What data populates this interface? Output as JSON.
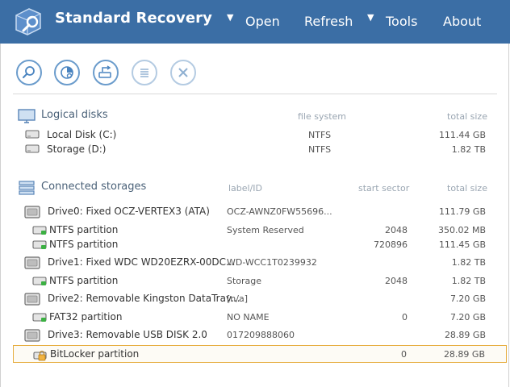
{
  "app": {
    "title": "Standard Recovery"
  },
  "menu": {
    "open": "Open",
    "refresh": "Refresh",
    "tools": "Tools",
    "about": "About",
    "arrow": "▼"
  },
  "toolbar": [
    {
      "name": "search-icon",
      "enabled": true
    },
    {
      "name": "scan-icon",
      "enabled": true
    },
    {
      "name": "image-disk-icon",
      "enabled": true
    },
    {
      "name": "list-icon",
      "enabled": false
    },
    {
      "name": "close-icon",
      "enabled": false
    }
  ],
  "logical": {
    "title": "Logical disks",
    "col_fs": "file system",
    "col_size": "total size",
    "rows": [
      {
        "name": "Local Disk (C:)",
        "fs": "NTFS",
        "size": "111.44 GB"
      },
      {
        "name": "Storage (D:)",
        "fs": "NTFS",
        "size": "1.82 TB"
      }
    ]
  },
  "storages": {
    "title": "Connected storages",
    "col_label": "label/ID",
    "col_sector": "start sector",
    "col_size": "total size",
    "rows": [
      {
        "kind": "drive",
        "name": "Drive0: Fixed OCZ-VERTEX3 (ATA)",
        "label": "OCZ-AWNZ0FW55696...",
        "sector": "",
        "size": "111.79 GB"
      },
      {
        "kind": "partition",
        "name": "NTFS partition",
        "label": "System Reserved",
        "sector": "2048",
        "size": "350.02 MB"
      },
      {
        "kind": "partition",
        "name": "NTFS partition",
        "label": "",
        "sector": "720896",
        "size": "111.45 GB"
      },
      {
        "kind": "drive",
        "name": "Drive1: Fixed WDC WD20EZRX-00DC...",
        "label": "WD-WCC1T0239932",
        "sector": "",
        "size": "1.82 TB"
      },
      {
        "kind": "partition",
        "name": "NTFS partition",
        "label": "Storage",
        "sector": "2048",
        "size": "1.82 TB"
      },
      {
        "kind": "drive",
        "name": "Drive2: Removable Kingston DataTrav...",
        "label": "[n/a]",
        "sector": "",
        "size": "7.20 GB"
      },
      {
        "kind": "partition",
        "name": "FAT32 partition",
        "label": "NO NAME",
        "sector": "0",
        "size": "7.20 GB"
      },
      {
        "kind": "drive",
        "name": "Drive3: Removable USB DISK 2.0",
        "label": "017209888060",
        "sector": "",
        "size": "28.89 GB"
      },
      {
        "kind": "locked",
        "name": "BitLocker partition",
        "label": "",
        "sector": "0",
        "size": "28.89 GB",
        "selected": true
      }
    ]
  },
  "colors": {
    "header_bg": "#3b6ea5",
    "selection_border": "#e6ad3e",
    "partition_led": "#3cb043"
  }
}
